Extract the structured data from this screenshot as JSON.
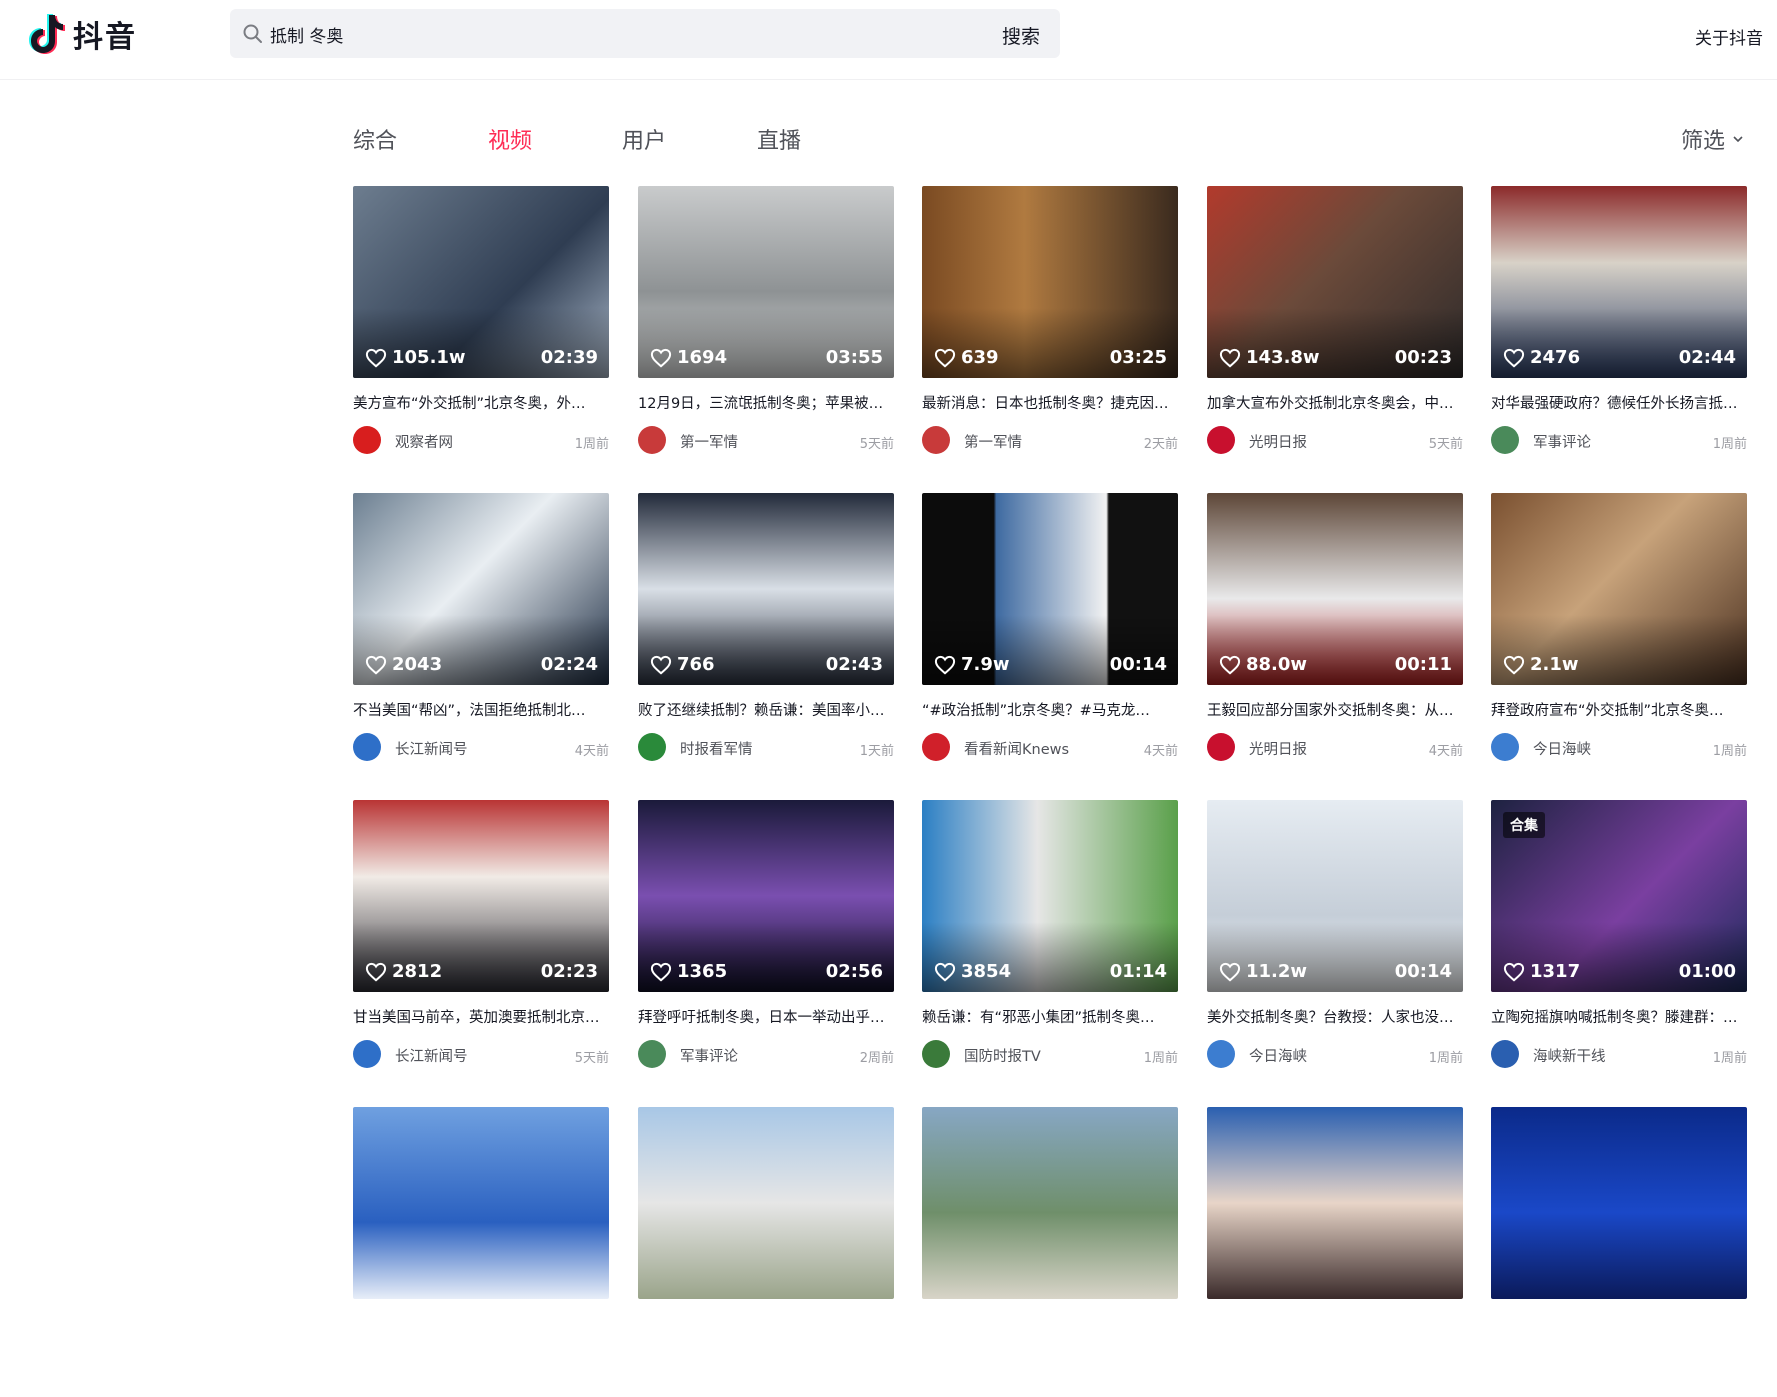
{
  "brand": {
    "name": "抖音"
  },
  "search": {
    "query": "抵制 冬奥",
    "button": "搜索"
  },
  "header": {
    "about": "关于抖音"
  },
  "tabs": [
    {
      "label": "综合",
      "active": false
    },
    {
      "label": "视频",
      "active": true
    },
    {
      "label": "用户",
      "active": false
    },
    {
      "label": "直播",
      "active": false
    }
  ],
  "filter": {
    "label": "筛选"
  },
  "colors": {
    "accent": "#fe2c55",
    "text": "#161823",
    "muted": "#9c9da3"
  },
  "videos": [
    {
      "likes": "105.1w",
      "duration": "02:39",
      "title": "美方宣布“外交抵制”北京冬奥，外…",
      "author": "观察者网",
      "time": "1周前"
    },
    {
      "likes": "1694",
      "duration": "03:55",
      "title": "12月9日，三流氓抵制冬奥；苹果被…",
      "author": "第一军情",
      "time": "5天前"
    },
    {
      "likes": "639",
      "duration": "03:25",
      "title": "最新消息：日本也抵制冬奥？捷克因…",
      "author": "第一军情",
      "time": "2天前"
    },
    {
      "likes": "143.8w",
      "duration": "00:23",
      "title": "加拿大宣布外交抵制北京冬奥会，中…",
      "author": "光明日报",
      "time": "5天前"
    },
    {
      "likes": "2476",
      "duration": "02:44",
      "title": "对华最强硬政府？德候任外长扬言抵…",
      "author": "军事评论",
      "time": "1周前"
    },
    {
      "likes": "2043",
      "duration": "02:24",
      "title": "不当美国“帮凶”，法国拒绝抵制北…",
      "author": "长江新闻号",
      "time": "4天前"
    },
    {
      "likes": "766",
      "duration": "02:43",
      "title": "败了还继续抵制？赖岳谦：美国率小…",
      "author": "时报看军情",
      "time": "1天前"
    },
    {
      "likes": "7.9w",
      "duration": "00:14",
      "title": "“#政治抵制”北京冬奥？#马克龙…",
      "author": "看看新闻Knews",
      "time": "4天前"
    },
    {
      "likes": "88.0w",
      "duration": "00:11",
      "title": "王毅回应部分国家外交抵制冬奥：从…",
      "author": "光明日报",
      "time": "4天前"
    },
    {
      "likes": "2.1w",
      "duration": "",
      "title": "拜登政府宣布“外交抵制”北京冬奥…",
      "author": "今日海峡",
      "time": "1周前"
    },
    {
      "likes": "2812",
      "duration": "02:23",
      "title": "甘当美国马前卒，英加澳要抵制北京…",
      "author": "长江新闻号",
      "time": "5天前"
    },
    {
      "likes": "1365",
      "duration": "02:56",
      "title": "拜登呼吁抵制冬奥，日本一举动出乎…",
      "author": "军事评论",
      "time": "2周前"
    },
    {
      "likes": "3854",
      "duration": "01:14",
      "title": "赖岳谦：有“邪恶小集团”抵制冬奥…",
      "author": "国防时报TV",
      "time": "1周前"
    },
    {
      "likes": "11.2w",
      "duration": "00:14",
      "title": "美外交抵制冬奥？台教授：人家也没…",
      "author": "今日海峡",
      "time": "1周前"
    },
    {
      "likes": "1317",
      "duration": "01:00",
      "title": "立陶宛摇旗呐喊抵制冬奥？滕建群：…",
      "author": "海峡新干线",
      "time": "1周前",
      "badge": "合集"
    },
    {
      "likes": "",
      "duration": "",
      "title": "",
      "author": "",
      "time": ""
    },
    {
      "likes": "",
      "duration": "",
      "title": "",
      "author": "",
      "time": ""
    },
    {
      "likes": "",
      "duration": "",
      "title": "",
      "author": "",
      "time": ""
    },
    {
      "likes": "",
      "duration": "",
      "title": "",
      "author": "",
      "time": ""
    },
    {
      "likes": "",
      "duration": "",
      "title": "",
      "author": "",
      "time": ""
    }
  ]
}
